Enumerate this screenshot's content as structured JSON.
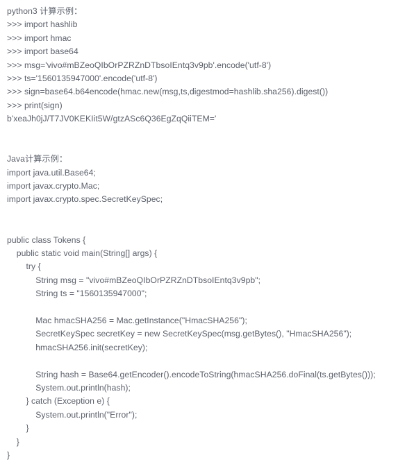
{
  "document": {
    "title": "HMAC-SHA256 signature calculation examples",
    "text_color": "#5b606b",
    "background_color": "#ffffff",
    "sections": [
      {
        "name": "python-example",
        "heading": "python3 计算示例：",
        "language": "python3",
        "lines": [
          ">>> import hashlib",
          ">>> import hmac",
          ">>> import base64",
          ">>> msg='vivo#mBZeoQIbOrPZRZnDTbsoIEntq3v9pb'.encode('utf-8')",
          ">>> ts='1560135947000'.encode('utf-8')",
          ">>> sign=base64.b64encode(hmac.new(msg,ts,digestmod=hashlib.sha256).digest())",
          ">>> print(sign)",
          "b'xeaJh0jJ/T7JV0KEKIit5W/gtzASc6Q36EgZqQiiTEM='"
        ]
      },
      {
        "name": "java-example",
        "heading": "Java计算示例：",
        "language": "Java",
        "lines": [
          "import java.util.Base64;",
          "import javax.crypto.Mac;",
          "import javax.crypto.spec.SecretKeySpec;",
          "",
          "public class Tokens {",
          "    public static void main(String[] args) {",
          "        try {",
          "            String msg = \"vivo#mBZeoQIbOrPZRZnDTbsoIEntq3v9pb\";",
          "            String ts = \"1560135947000\";",
          "",
          "            Mac hmacSHA256 = Mac.getInstance(\"HmacSHA256\");",
          "            SecretKeySpec secretKey = new SecretKeySpec(msg.getBytes(), \"HmacSHA256\");",
          "            hmacSHA256.init(secretKey);",
          "",
          "            String hash = Base64.getEncoder().encodeToString(hmacSHA256.doFinal(ts.getBytes()));",
          "            System.out.println(hash);",
          "        } catch (Exception e) {",
          "            System.out.println(\"Error\");",
          "        }",
          "    }",
          "}"
        ]
      }
    ],
    "values": {
      "app_key_msg": "vivo#mBZeoQIbOrPZRZnDTbsoIEntq3v9pb",
      "timestamp": "1560135947000",
      "python_signature_output": "b'xeaJh0jJ/T7JV0KEKIit5W/gtzASc6Q36EgZqQiiTEM='",
      "hmac_algorithm_python": "hashlib.sha256",
      "hmac_algorithm_java": "HmacSHA256",
      "java_class_name": "Tokens"
    }
  }
}
